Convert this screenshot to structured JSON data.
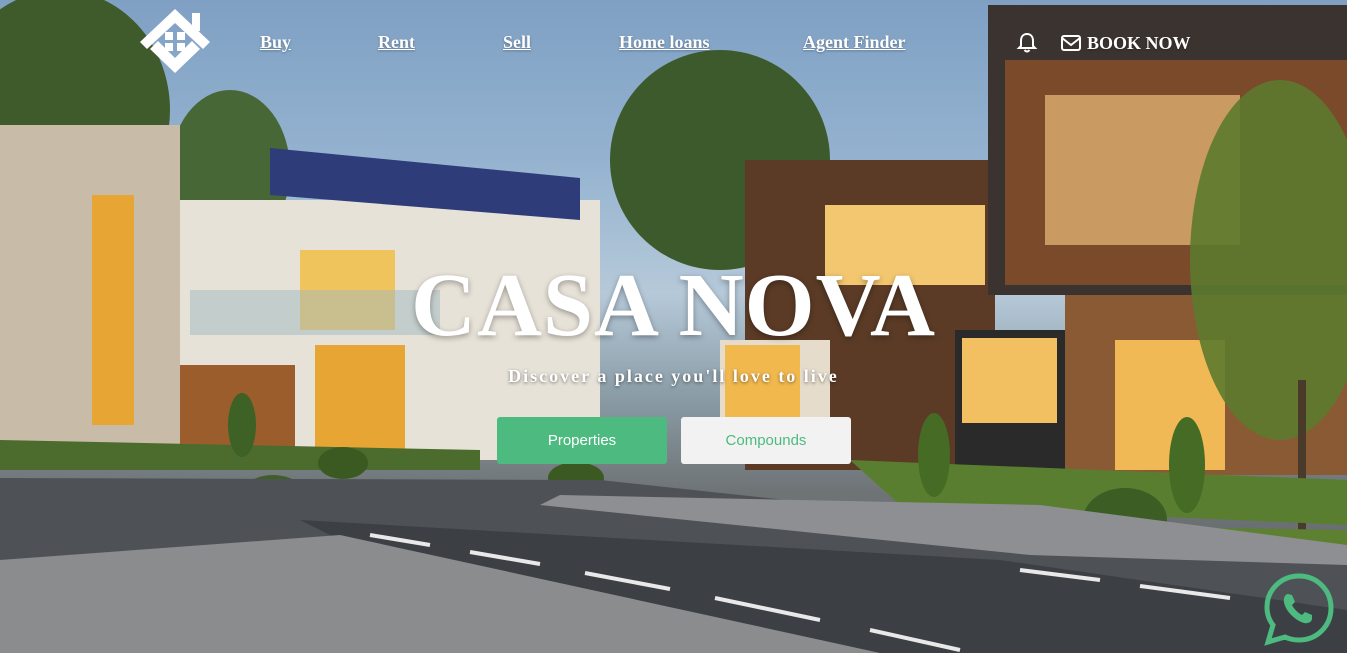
{
  "nav": {
    "links": [
      {
        "label": "Buy"
      },
      {
        "label": "Rent"
      },
      {
        "label": "Sell"
      },
      {
        "label": "Home loans"
      },
      {
        "label": "Agent Finder"
      }
    ],
    "notification_icon": "bell-icon",
    "book_icon": "envelope-icon",
    "book_label": "BOOK NOW"
  },
  "logo": {
    "icon": "house-logo-icon"
  },
  "hero": {
    "title": "CASA NOVA",
    "subtitle": "Discover a place you'll love to live",
    "primary_button": "Properties",
    "secondary_button": "Compounds"
  },
  "colors": {
    "accent": "#4dba80",
    "secondary_button_bg": "#f2f2f2",
    "text_on_image": "#ffffff"
  },
  "floating": {
    "whatsapp_icon": "whatsapp-icon"
  }
}
